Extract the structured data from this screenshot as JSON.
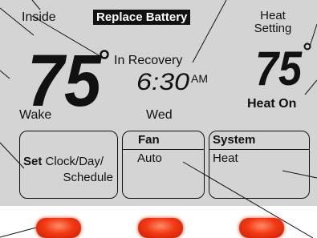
{
  "display": {
    "inside_label": "Inside",
    "replace_battery": "Replace Battery",
    "inside_temp": "75",
    "heat_setting_line1": "Heat",
    "heat_setting_line2": "Setting",
    "set_temp": "75",
    "recovery_status": "In Recovery",
    "time": "6:30",
    "ampm": "AM",
    "period": "Wake",
    "day": "Wed",
    "heat_status": "Heat On"
  },
  "buttons": {
    "set_bold": "Set",
    "set_rest": "Clock/Day/",
    "set_line2": "Schedule",
    "fan_header": "Fan",
    "fan_value": "Auto",
    "system_header": "System",
    "system_value": "Heat"
  },
  "colors": {
    "lcd_background": "#d4d4d4",
    "button_led": "#f23a15"
  }
}
